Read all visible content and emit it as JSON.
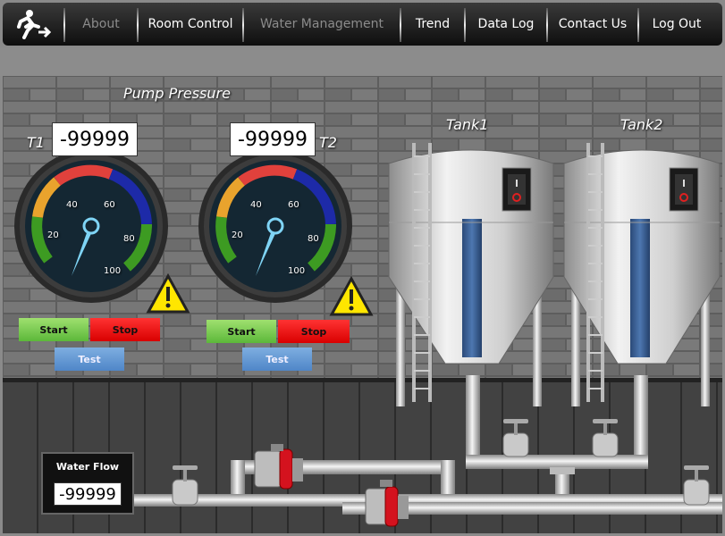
{
  "nav": {
    "items": [
      {
        "label": "About",
        "active": false
      },
      {
        "label": "Room Control",
        "active": true
      },
      {
        "label": "Water Management",
        "active": false
      },
      {
        "label": "Trend",
        "active": true
      },
      {
        "label": "Data Log",
        "active": true
      },
      {
        "label": "Contact Us",
        "active": true
      },
      {
        "label": "Log Out",
        "active": true
      }
    ]
  },
  "pump_pressure": {
    "title": "Pump Pressure",
    "gauge_ticks": [
      "20",
      "40",
      "60",
      "80",
      "100"
    ],
    "t1": {
      "label": "T1",
      "value": "-99999",
      "start": "Start",
      "stop": "Stop",
      "test": "Test"
    },
    "t2": {
      "label": "T2",
      "value": "-99999",
      "start": "Start",
      "stop": "Stop",
      "test": "Test"
    }
  },
  "tanks": {
    "tank1": {
      "label": "Tank1"
    },
    "tank2": {
      "label": "Tank2"
    }
  },
  "water_flow": {
    "label": "Water Flow",
    "value": "-99999"
  },
  "colors": {
    "gauge_red": "#e0413c",
    "gauge_orange": "#e9a32d",
    "gauge_green": "#3d9b22",
    "gauge_blue": "#1d2aa8",
    "needle": "#7fd4f5",
    "valve_red": "#d4121e"
  }
}
